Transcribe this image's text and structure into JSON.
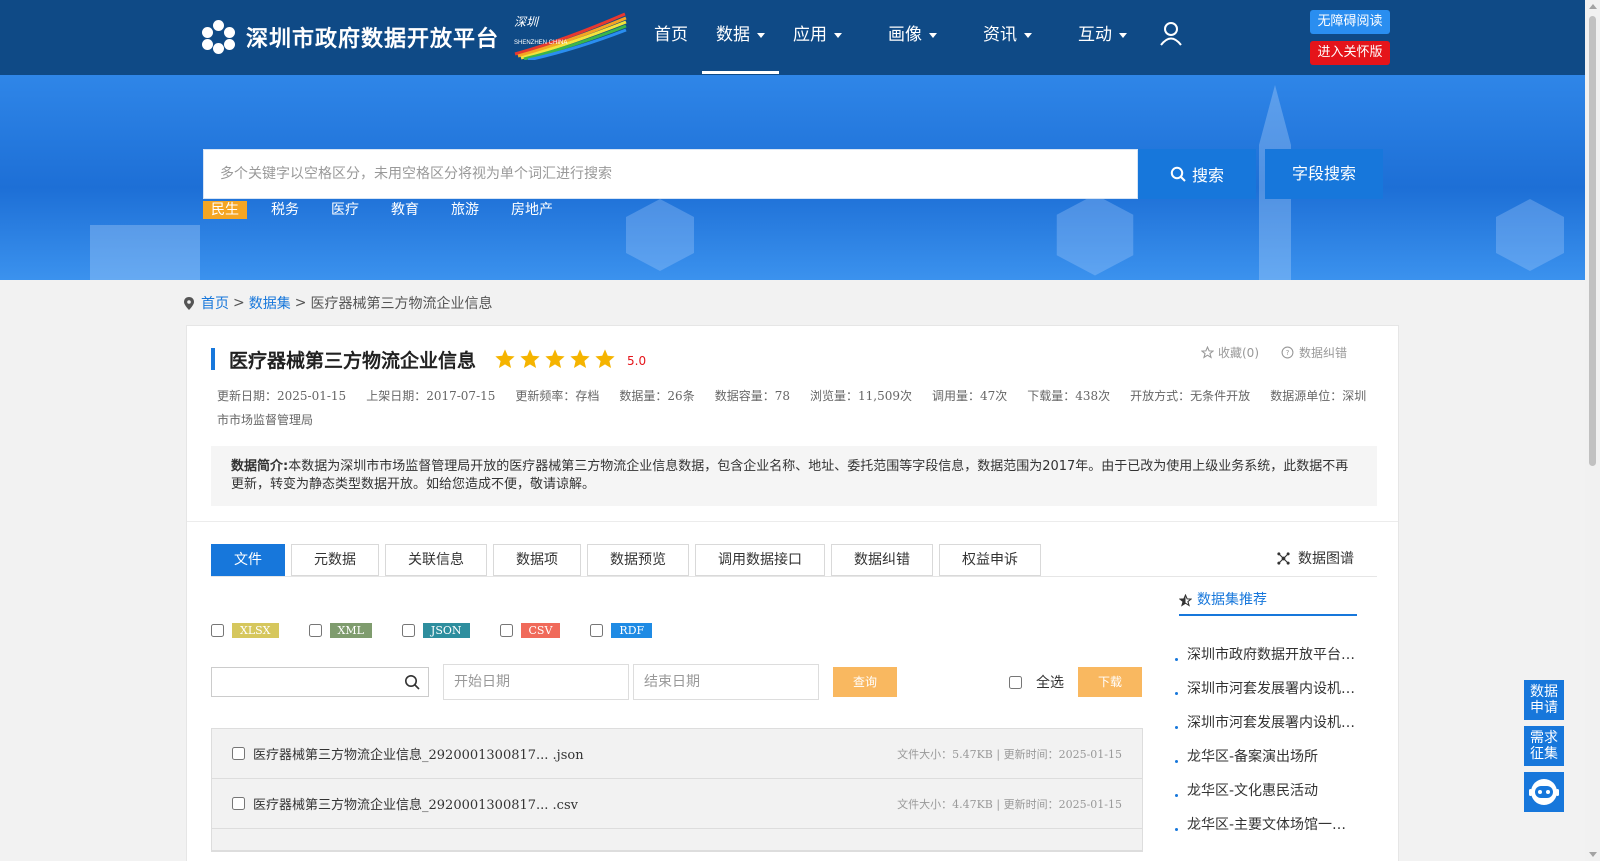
{
  "header": {
    "site_title": "深圳市政府数据开放平台",
    "badge_text": "SHENZHEN CHINA",
    "nav": [
      {
        "label": "首页",
        "dropdown": false,
        "active": false
      },
      {
        "label": "数据",
        "dropdown": true,
        "active": true
      },
      {
        "label": "应用",
        "dropdown": true,
        "active": false
      },
      {
        "label": "画像",
        "dropdown": true,
        "active": false
      },
      {
        "label": "资讯",
        "dropdown": true,
        "active": false
      },
      {
        "label": "互动",
        "dropdown": true,
        "active": false
      }
    ],
    "accessibility_label": "无障碍阅读",
    "elder_label": "进入关怀版"
  },
  "search": {
    "placeholder": "多个关键字以空格区分，未用空格区分将视为单个词汇进行搜索",
    "search_label": "搜索",
    "field_search_label": "字段搜索",
    "hot_tags": [
      "民生",
      "税务",
      "医疗",
      "教育",
      "旅游",
      "房地产"
    ]
  },
  "breadcrumb": {
    "home": "首页",
    "datasets": "数据集",
    "current": "医疗器械第三方物流企业信息",
    "sep": ">"
  },
  "dataset": {
    "title": "医疗器械第三方物流企业信息",
    "rating": "5.0",
    "star_count": 5,
    "collect": "收藏(0)",
    "feedback": "数据纠错",
    "meta": {
      "update_date": "更新日期：2025-01-15",
      "publish_date": "上架日期：2017-07-15",
      "frequency": "更新频率：存档",
      "records": "数据量：26条",
      "capacity": "数据容量：78",
      "views": "浏览量：11,509次",
      "calls": "调用量：47次",
      "downloads": "下载量：438次",
      "open_mode": "开放方式：无条件开放",
      "source": "数据源单位：深圳市市场监督管理局"
    },
    "summary_label": "数据简介:",
    "summary_text": "本数据为深圳市市场监督管理局开放的医疗器械第三方物流企业信息数据，包含企业名称、地址、委托范围等字段信息，数据范围为2017年。由于已改为使用上级业务系统，此数据不再更新，转变为静态类型数据开放。如给您造成不便，敬请谅解。"
  },
  "tabs": [
    "文件",
    "元数据",
    "关联信息",
    "数据项",
    "数据预览",
    "调用数据接口",
    "数据纠错",
    "权益申诉"
  ],
  "graph_link": "数据图谱",
  "formats": [
    {
      "label": "XLSX",
      "color": "#d6c75d"
    },
    {
      "label": "XML",
      "color": "#7f9c6e"
    },
    {
      "label": "JSON",
      "color": "#2e8e9e"
    },
    {
      "label": "CSV",
      "color": "#f06a5a"
    },
    {
      "label": "RDF",
      "color": "#1f8be4"
    }
  ],
  "filters": {
    "start_date": "开始日期",
    "end_date": "结束日期",
    "query_label": "查询",
    "select_all": "全选",
    "download_label": "下载"
  },
  "files": [
    {
      "name": "医疗器械第三方物流企业信息_2920001300817... .json",
      "meta": "文件大小：5.47KB | 更新时间：2025-01-15"
    },
    {
      "name": "医疗器械第三方物流企业信息_2920001300817... .csv",
      "meta": "文件大小：4.47KB | 更新时间：2025-01-15"
    }
  ],
  "recommend": {
    "title": "数据集推荐",
    "items": [
      "深圳市政府数据开放平台…",
      "深圳市河套发展署内设机…",
      "深圳市河套发展署内设机…",
      "龙华区-备案演出场所",
      "龙华区-文化惠民活动",
      "龙华区-主要文体场馆一…"
    ]
  },
  "side_tools": {
    "apply": "数据申请",
    "demand": "需求征集"
  },
  "colors": {
    "header_bg": "#0f4a86",
    "accent": "#1777db",
    "star": "#f5b400",
    "hot_tag": "#f5a623",
    "button_orange": "#f9b860"
  }
}
